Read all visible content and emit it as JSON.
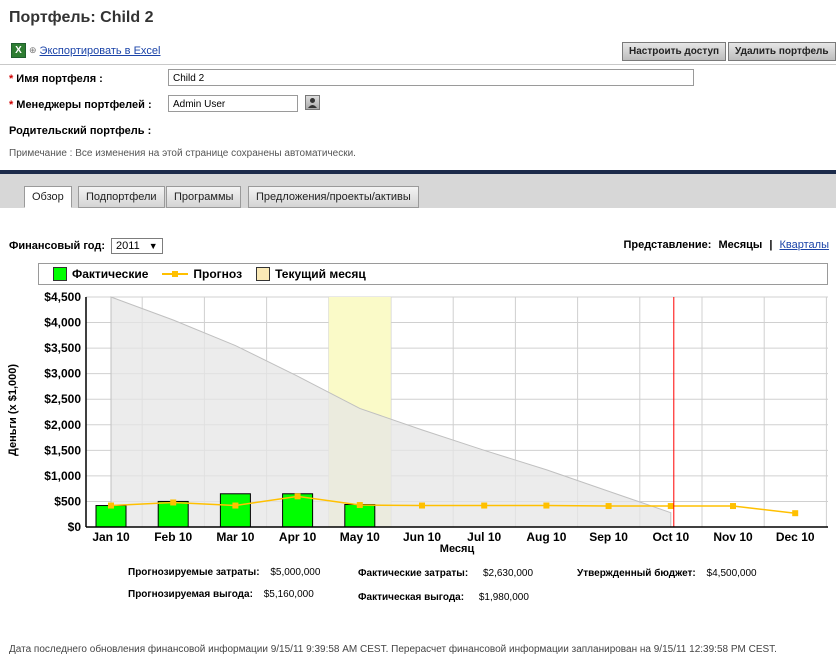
{
  "title": "Портфель: Child 2",
  "toolbar": {
    "export_label": "Экспортировать в Excel",
    "configure_label": "Настроить доступ",
    "delete_label": "Удалить портфель"
  },
  "form": {
    "name_label": "Имя портфеля :",
    "name_value": "Child 2",
    "managers_label": "Менеджеры портфелей :",
    "managers_value": "Admin User",
    "parent_label": "Родительский портфель :"
  },
  "note": "Примечание : Все изменения на этой странице сохранены автоматически.",
  "tabs": [
    {
      "label": "Обзор"
    },
    {
      "label": "Подпортфели"
    },
    {
      "label": "Программы"
    },
    {
      "label": "Предложения/проекты/активы"
    }
  ],
  "fiscal": {
    "label": "Финансовый год:",
    "value": "2011"
  },
  "view": {
    "label": "Представление:",
    "months": "Месяцы",
    "separator": "|",
    "quarters": "Кварталы"
  },
  "legend": {
    "actual": "Фактические",
    "forecast": "Прогноз",
    "current": "Текущий месяц"
  },
  "colors": {
    "actual": "#00ff00",
    "forecast": "#ffc000",
    "current_month": "#fafac8",
    "today_line": "#ff0000",
    "budget_area": "#e6e6e6"
  },
  "chart_data": {
    "type": "bar",
    "categories": [
      "Jan 10",
      "Feb 10",
      "Mar 10",
      "Apr 10",
      "May 10",
      "Jun 10",
      "Jul 10",
      "Aug 10",
      "Sep 10",
      "Oct 10",
      "Nov 10",
      "Dec 10"
    ],
    "ylabel": "Деньги (x $1,000)",
    "xlabel": "Месяц",
    "ylim": [
      0,
      4500
    ],
    "yticks": [
      "$0",
      "$500",
      "$1,000",
      "$1,500",
      "$2,000",
      "$2,500",
      "$3,000",
      "$3,500",
      "$4,000",
      "$4,500"
    ],
    "series": [
      {
        "name": "Фактические",
        "type": "bar",
        "values": [
          420,
          500,
          650,
          650,
          440,
          null,
          null,
          null,
          null,
          null,
          null,
          null
        ]
      },
      {
        "name": "Прогноз",
        "type": "line",
        "values": [
          420,
          480,
          420,
          600,
          430,
          420,
          420,
          420,
          410,
          410,
          410,
          270
        ]
      },
      {
        "type": "area",
        "values": [
          4500,
          4050,
          3550,
          2950,
          2320,
          1900,
          1500,
          1120,
          700,
          280
        ]
      }
    ],
    "current_month_index": 4,
    "today_index": 9,
    "grid": true
  },
  "summary": {
    "forecast_cost_label": "Прогнозируемые затраты:",
    "forecast_cost_value": "$5,000,000",
    "actual_cost_label": "Фактические затраты:",
    "actual_cost_value": "$2,630,000",
    "budget_label": "Утвержденный бюджет:",
    "budget_value": "$4,500,000",
    "forecast_benefit_label": "Прогнозируемая выгода:",
    "forecast_benefit_value": "$5,160,000",
    "actual_benefit_label": "Фактическая выгода:",
    "actual_benefit_value": "$1,980,000"
  },
  "footer": "Дата последнего обновления финансовой информации 9/15/11 9:39:58 AM CEST. Перерасчет финансовой информации запланирован на 9/15/11 12:39:58 PM CEST."
}
